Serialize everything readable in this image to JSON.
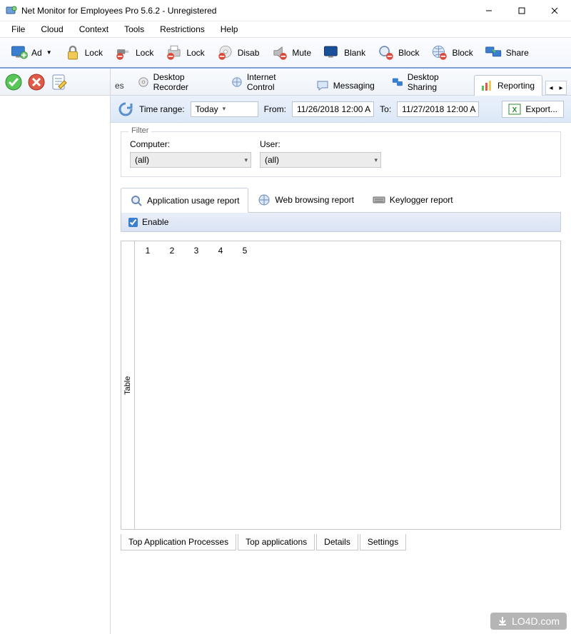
{
  "window": {
    "title": "Net Monitor for Employees Pro 5.6.2 - Unregistered"
  },
  "menu": {
    "items": [
      "File",
      "Cloud",
      "Context",
      "Tools",
      "Restrictions",
      "Help"
    ]
  },
  "toolbar": {
    "add": "Ad",
    "lock1": "Lock",
    "lock2": "Lock",
    "lock3": "Lock",
    "disable": "Disab",
    "mute": "Mute",
    "blank": "Blank",
    "block1": "Block",
    "block2": "Block",
    "share": "Share"
  },
  "tabs": {
    "truncated": "es",
    "desktop_recorder": "Desktop Recorder",
    "internet_control": "Internet Control",
    "messaging": "Messaging",
    "desktop_sharing": "Desktop Sharing",
    "reporting": "Reporting"
  },
  "timerange": {
    "label": "Time range:",
    "selected": "Today",
    "from_label": "From:",
    "from_value": "11/26/2018 12:00 A",
    "to_label": "To:",
    "to_value": "11/27/2018 12:00 A",
    "export": "Export..."
  },
  "filter": {
    "legend": "Filter",
    "computer_label": "Computer:",
    "computer_value": "(all)",
    "user_label": "User:",
    "user_value": "(all)"
  },
  "subtabs": {
    "app_usage": "Application usage report",
    "web_browsing": "Web browsing report",
    "keylogger": "Keylogger report"
  },
  "enable": {
    "label": "Enable"
  },
  "grid": {
    "vlabel": "Table",
    "columns": [
      "1",
      "2",
      "3",
      "4",
      "5"
    ]
  },
  "bottomtabs": {
    "top_processes": "Top Application Processes",
    "top_apps": "Top applications",
    "details": "Details",
    "settings": "Settings"
  },
  "watermark": {
    "text": "LO4D.com"
  }
}
